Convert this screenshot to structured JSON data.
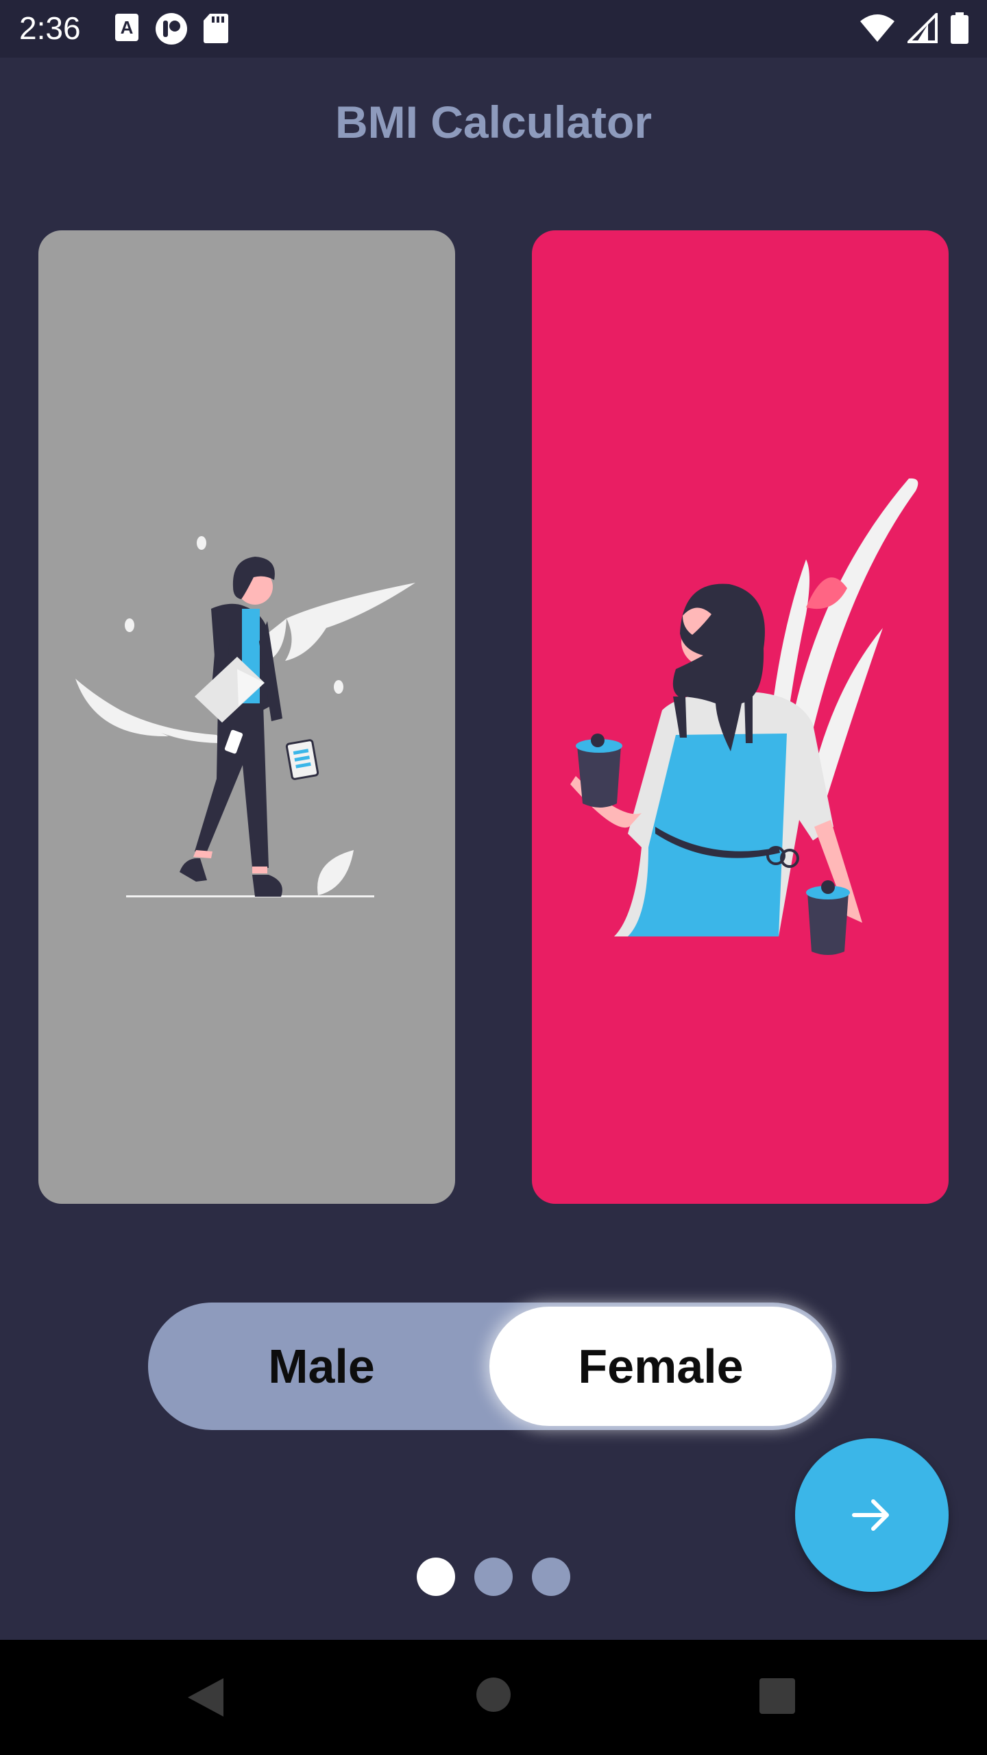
{
  "status_bar": {
    "time": "2:36",
    "left_icons": [
      "a-keyboard-icon",
      "app-notification-icon",
      "sd-card-icon"
    ],
    "right_icons": [
      "wifi-icon",
      "cellular-signal-icon",
      "battery-icon"
    ]
  },
  "app": {
    "title": "BMI Calculator",
    "colors": {
      "background": "#2c2c44",
      "title": "#8e9bbd",
      "male_card": "#9e9e9e",
      "female_card": "#e91e63",
      "accent": "#3bb6e8",
      "toggle_track": "#8e9bbd"
    }
  },
  "gender_cards": [
    {
      "id": "male",
      "illustration": "man-walking-illustration",
      "selected": false
    },
    {
      "id": "female",
      "illustration": "woman-barista-illustration",
      "selected": true
    }
  ],
  "gender_toggle": {
    "options": [
      "Male",
      "Female"
    ],
    "selected": "Female"
  },
  "next_button": {
    "icon": "arrow-right-icon"
  },
  "page_indicator": {
    "count": 3,
    "active_index": 0
  },
  "nav_bar": {
    "icons": [
      "back-icon",
      "home-icon",
      "recents-icon"
    ]
  }
}
